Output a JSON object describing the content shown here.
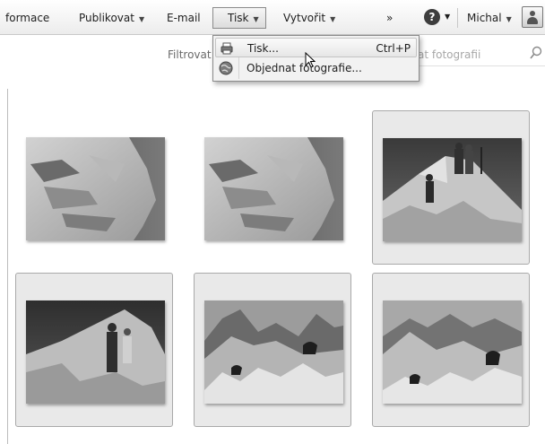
{
  "toolbar": {
    "items": [
      {
        "label": "formace",
        "dropdown": false
      },
      {
        "label": "Publikovat",
        "dropdown": true
      },
      {
        "label": "E-mail",
        "dropdown": false
      },
      {
        "label": "Tisk",
        "dropdown": true
      },
      {
        "label": "Vytvořit",
        "dropdown": true
      },
      {
        "label": "»",
        "dropdown": false
      }
    ],
    "help_glyph": "?",
    "user": "Michal",
    "dropdown_arrow": "▼"
  },
  "subbar": {
    "filter_label": "Filtrovat",
    "search_placeholder": "at fotografii"
  },
  "print_menu": {
    "items": [
      {
        "label": "Tisk...",
        "shortcut": "Ctrl+P",
        "icon": "printer-icon",
        "highlighted": true
      },
      {
        "label": "Objednat fotografie...",
        "shortcut": "",
        "icon": "globe-icon",
        "highlighted": false
      }
    ]
  },
  "photos": [
    {
      "name": "rock-face-1",
      "selected": false
    },
    {
      "name": "rock-face-2",
      "selected": false
    },
    {
      "name": "climbers-summit",
      "selected": true
    },
    {
      "name": "climbers-ridge",
      "selected": true
    },
    {
      "name": "mountains-bird-1",
      "selected": true
    },
    {
      "name": "mountains-bird-2",
      "selected": true
    }
  ]
}
